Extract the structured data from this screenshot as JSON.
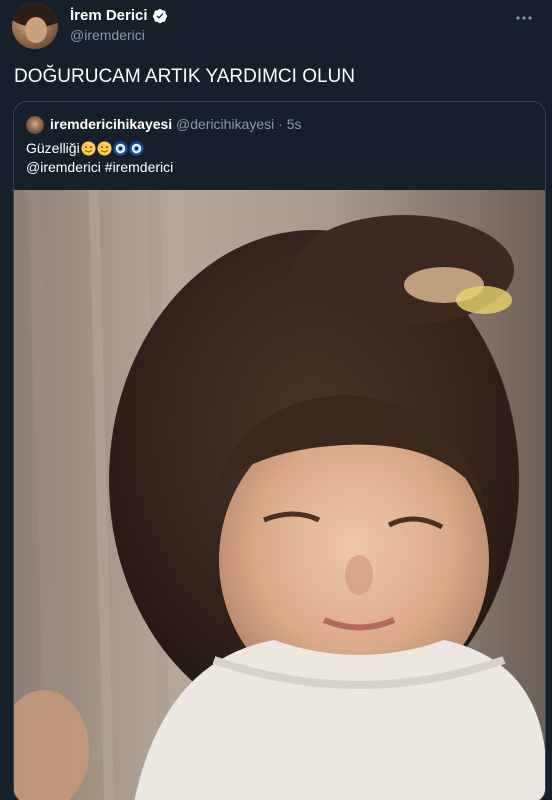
{
  "tweet": {
    "author": {
      "display_name": "İrem Derici",
      "handle": "@iremderici",
      "verified": true,
      "avatar_icon": "profile-photo-avatar"
    },
    "text": "DOĞURUCAM ARTIK YARDIMCI OLUN",
    "more_icon": "more-options-icon"
  },
  "quote": {
    "author": {
      "display_name": "iremdericihikayesi",
      "handle": "@dericihikayesi · 5s"
    },
    "text_prefix": "Güzelliği",
    "emojis": [
      "smiling-face-with-tear-emoji",
      "smiling-face-with-tear-emoji",
      "nazar-amulet-emoji",
      "nazar-amulet-emoji"
    ],
    "text_line2": "@iremderici #iremderici",
    "media": {
      "type": "photo",
      "icon": "childhood-portrait-photo"
    }
  },
  "colors": {
    "background": "#15202b",
    "border": "#38444d",
    "secondary_text": "#8899a6",
    "primary_text": "#ffffff",
    "verified_badge": "#ffffff"
  }
}
